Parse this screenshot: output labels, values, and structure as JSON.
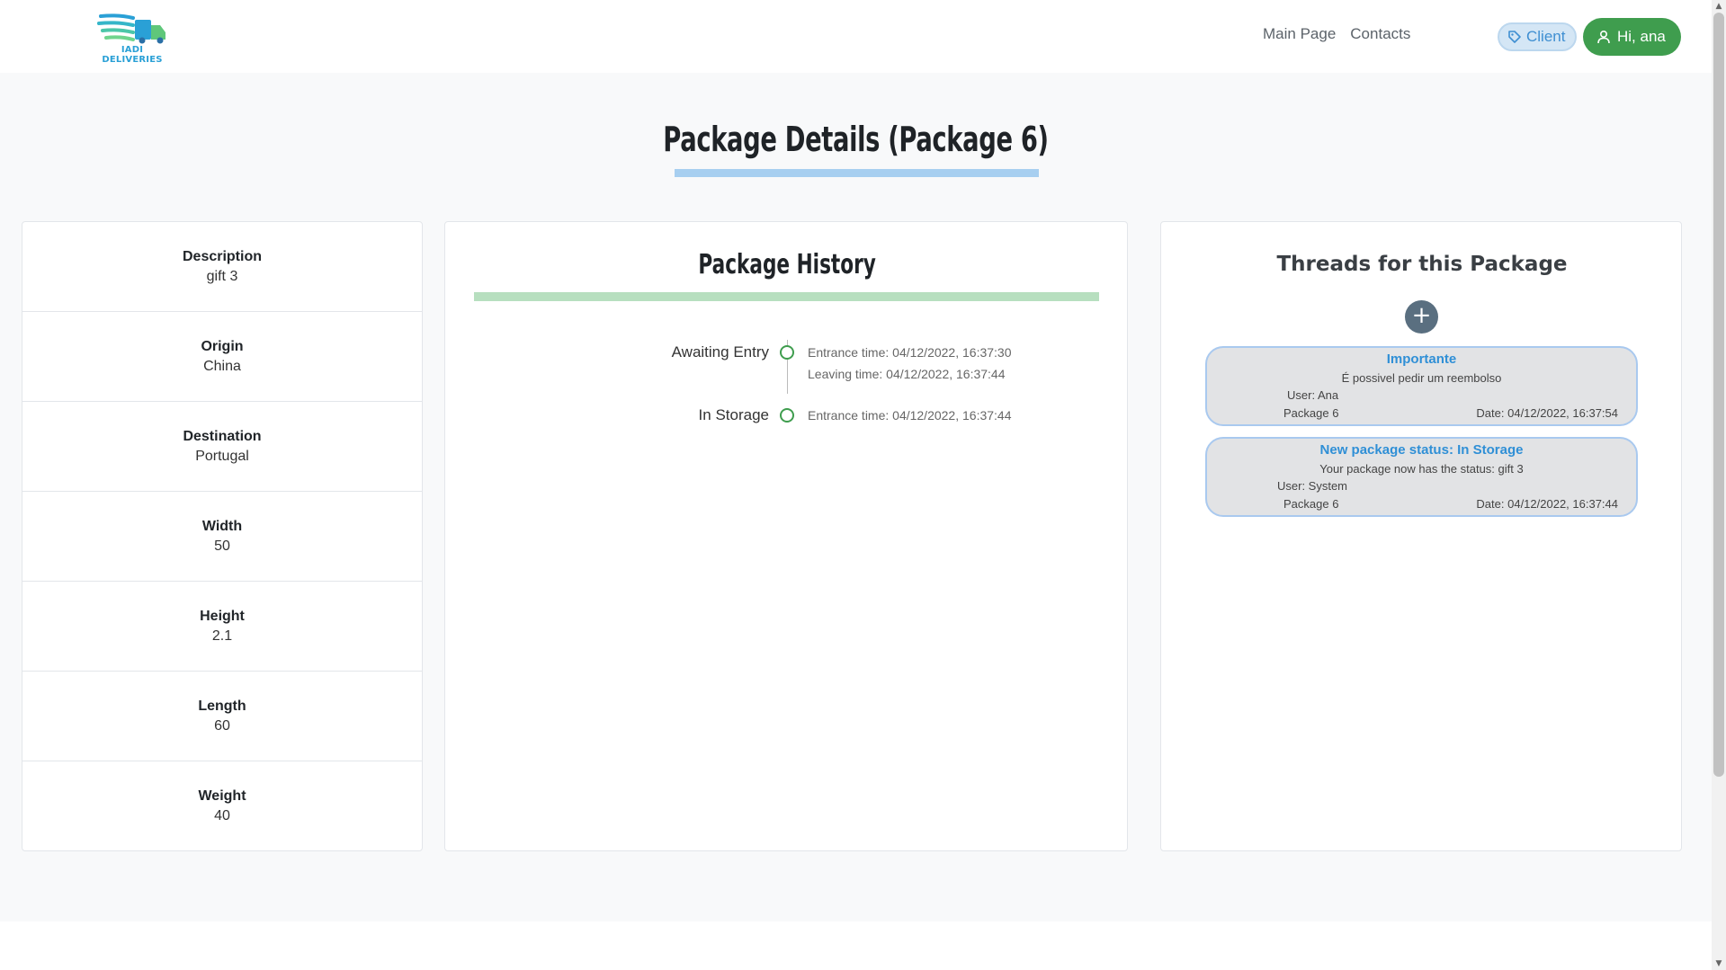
{
  "header": {
    "logo_text": "IADI DELIVERIES",
    "nav": [
      "Main Page",
      "Contacts"
    ],
    "role_label": "Client",
    "user_label": "Hi, ana"
  },
  "page": {
    "title": "Package Details (Package 6)"
  },
  "details": [
    {
      "label": "Description",
      "value": "gift 3"
    },
    {
      "label": "Origin",
      "value": "China"
    },
    {
      "label": "Destination",
      "value": "Portugal"
    },
    {
      "label": "Width",
      "value": "50"
    },
    {
      "label": "Height",
      "value": "2.1"
    },
    {
      "label": "Length",
      "value": "60"
    },
    {
      "label": "Weight",
      "value": "40"
    }
  ],
  "history": {
    "title": "Package History",
    "entries": [
      {
        "status": "Awaiting Entry",
        "entrance": "Entrance time: 04/12/2022, 16:37:30",
        "leaving": "Leaving time: 04/12/2022, 16:37:44"
      },
      {
        "status": "In Storage",
        "entrance": "Entrance time: 04/12/2022, 16:37:44",
        "leaving": ""
      }
    ]
  },
  "threads": {
    "title": "Threads for this Package",
    "add_label": "+",
    "items": [
      {
        "title": "Importante",
        "message": "É possivel pedir um reembolso",
        "user": "User: Ana",
        "package": "Package 6",
        "date": "Date: 04/12/2022, 16:37:54"
      },
      {
        "title": "New package status: In Storage",
        "message": "Your package now has the status: gift 3",
        "user": "User: System",
        "package": "Package 6",
        "date": "Date: 04/12/2022, 16:37:44"
      }
    ]
  },
  "colors": {
    "accent_blue": "#2f8fd6",
    "user_button": "#3f9d4e",
    "title_underline": "#a7cff0",
    "history_underline": "#b7dfbf"
  }
}
